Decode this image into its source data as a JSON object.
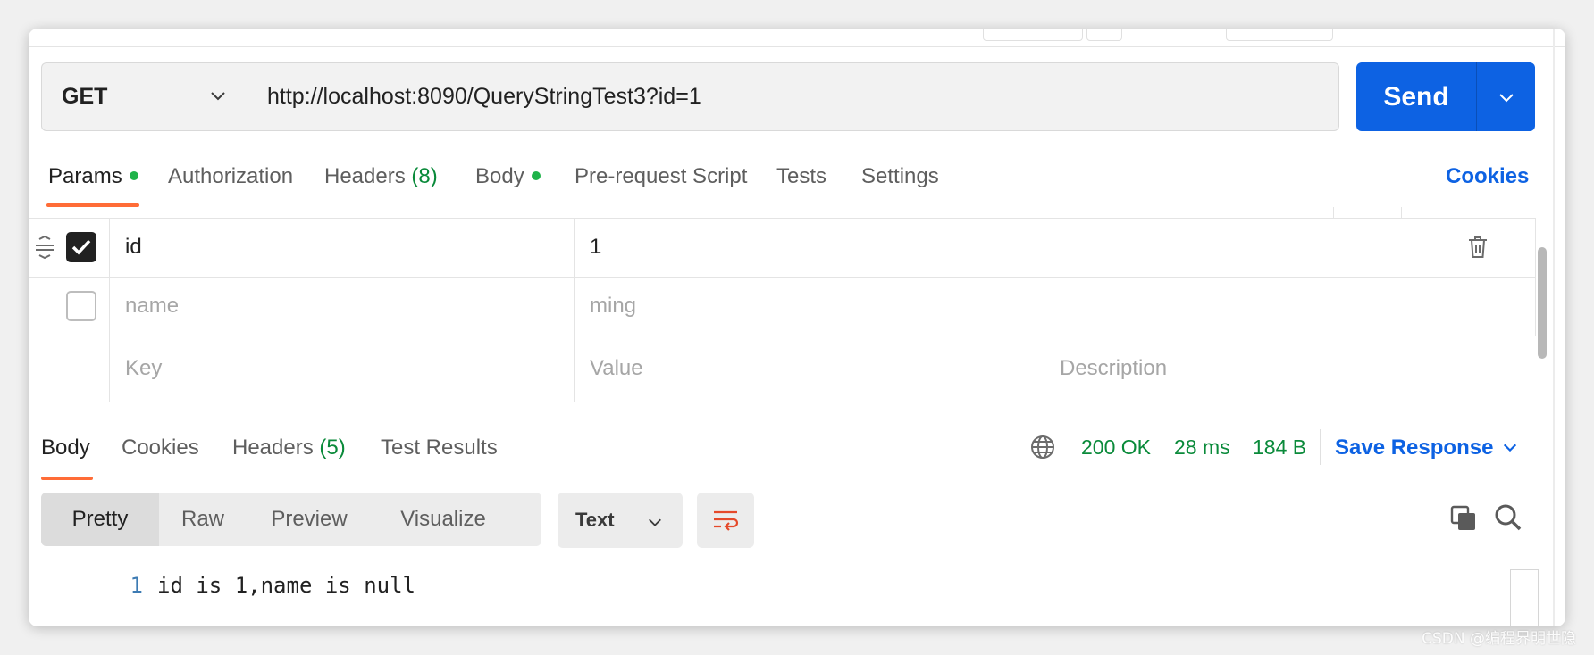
{
  "request": {
    "method": "GET",
    "url": "http://localhost:8090/QueryStringTest3?id=1",
    "send_label": "Send"
  },
  "request_tabs": [
    {
      "label": "Params",
      "dot": true,
      "active": true
    },
    {
      "label": "Authorization"
    },
    {
      "label": "Headers",
      "count": "(8)"
    },
    {
      "label": "Body",
      "dot": true
    },
    {
      "label": "Pre-request Script"
    },
    {
      "label": "Tests"
    },
    {
      "label": "Settings"
    }
  ],
  "cookies_link": "Cookies",
  "params": {
    "rows": [
      {
        "checked": true,
        "key": "id",
        "value": "1",
        "description": ""
      },
      {
        "checked": false,
        "key": "name",
        "value": "ming",
        "description": ""
      }
    ],
    "placeholder": {
      "key": "Key",
      "value": "Value",
      "description": "Description"
    }
  },
  "response_tabs": [
    {
      "label": "Body",
      "active": true
    },
    {
      "label": "Cookies"
    },
    {
      "label": "Headers",
      "count": "(5)"
    },
    {
      "label": "Test Results"
    }
  ],
  "response_status": {
    "code": "200 OK",
    "time": "28 ms",
    "size": "184 B"
  },
  "save_response_label": "Save Response",
  "view_modes": [
    "Pretty",
    "Raw",
    "Preview",
    "Visualize"
  ],
  "active_view_mode": "Pretty",
  "format": "Text",
  "response_body": {
    "line_number": "1",
    "text": "id is 1,name is null"
  },
  "watermark": "CSDN @编程界明世隐",
  "icons": {
    "method_dropdown": "chevron-down-icon",
    "send_dropdown": "chevron-down-icon",
    "drag": "drag-handle-icon",
    "checkbox": "check-icon",
    "delete": "trash-icon",
    "network": "globe-icon",
    "wrap": "wrap-lines-icon",
    "copy": "copy-icon",
    "search": "search-icon"
  },
  "colors": {
    "accent": "#ff6c37",
    "primary": "#0d62e3",
    "success": "#0a8a3a"
  }
}
